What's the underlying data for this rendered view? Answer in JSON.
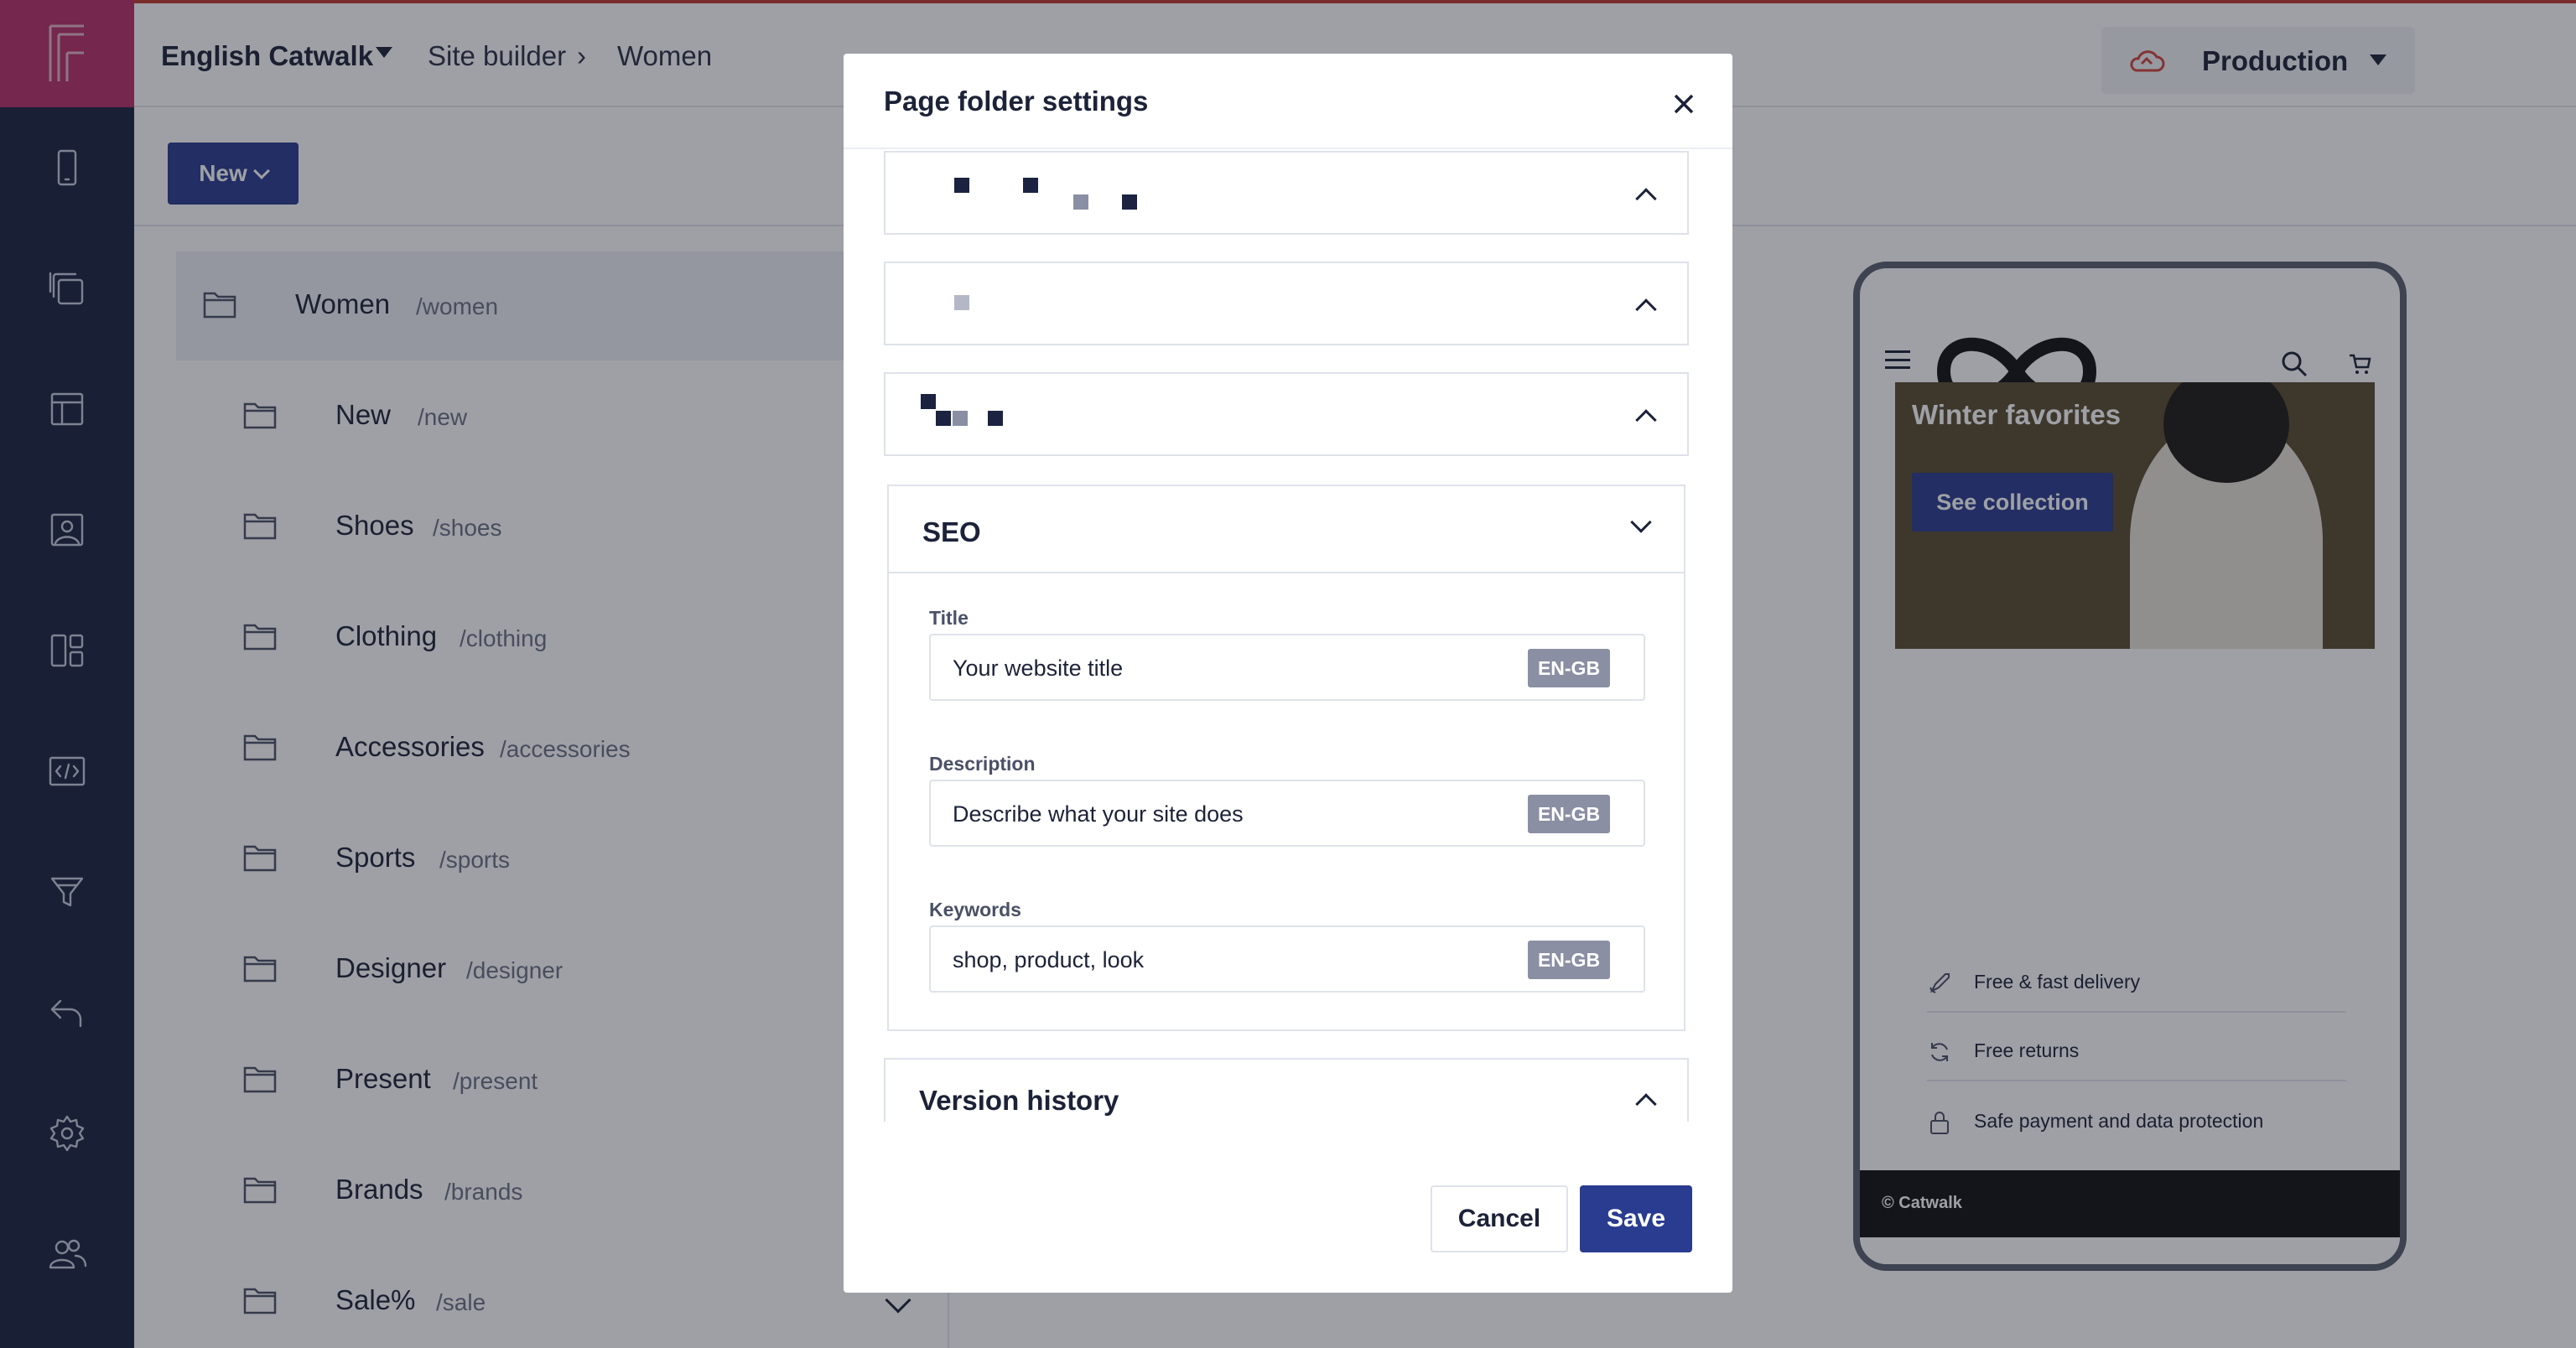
{
  "topbar": {
    "project": "English Catwalk",
    "breadcrumb": [
      "Site builder",
      "Women"
    ],
    "breadcrumb_separator": "›",
    "environment": "Production"
  },
  "toolbar": {
    "new_label": "New"
  },
  "tree": {
    "root": {
      "name": "Women",
      "path": "/women"
    },
    "items": [
      {
        "name": "New",
        "path": "/new"
      },
      {
        "name": "Shoes",
        "path": "/shoes"
      },
      {
        "name": "Clothing",
        "path": "/clothing"
      },
      {
        "name": "Accessories",
        "path": "/accessories"
      },
      {
        "name": "Sports",
        "path": "/sports"
      },
      {
        "name": "Designer",
        "path": "/designer"
      },
      {
        "name": "Present",
        "path": "/present"
      },
      {
        "name": "Brands",
        "path": "/brands"
      },
      {
        "name": "Sale%",
        "path": "/sale"
      }
    ]
  },
  "modal": {
    "title": "Page folder settings",
    "seo": {
      "heading": "SEO",
      "title_label": "Title",
      "title_value": "Your website title",
      "description_label": "Description",
      "description_value": "Describe what your site does",
      "keywords_label": "Keywords",
      "keywords_value": "shop, product, look",
      "locale_badge": "EN-GB"
    },
    "version_history": "Version history",
    "cancel_label": "Cancel",
    "save_label": "Save"
  },
  "preview": {
    "hero_title": "Winter favorites",
    "hero_button": "See collection",
    "usps": [
      "Free & fast delivery",
      "Free returns",
      "Safe payment and data protection"
    ],
    "footer": "© Catwalk"
  },
  "colors": {
    "rail": "#1b2340",
    "brand": "#b8306a",
    "primary": "#2a3c8f",
    "badge": "#8a8fa3",
    "env_cloud": "#d0463f"
  }
}
